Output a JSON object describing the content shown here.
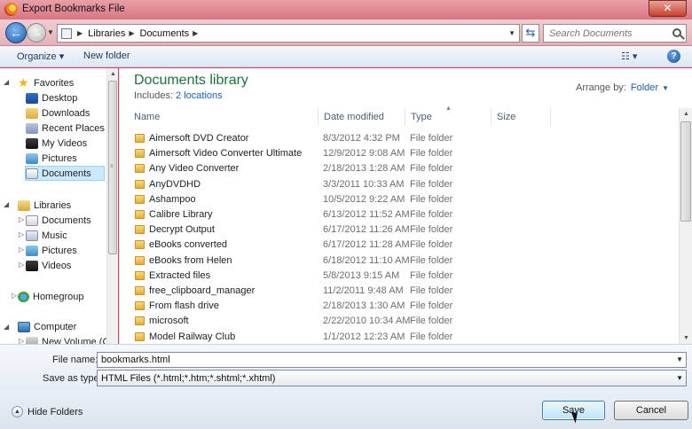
{
  "window": {
    "title": "Export Bookmarks File",
    "close_label": "✕"
  },
  "address": {
    "crumbs": [
      "Libraries",
      "Documents"
    ],
    "search_placeholder": "Search Documents"
  },
  "toolbar": {
    "organize_label": "Organize ▾",
    "new_folder_label": "New folder"
  },
  "nav": {
    "favorites": "Favorites",
    "favorite_items": [
      "Desktop",
      "Downloads",
      "Recent Places",
      "My Videos",
      "Pictures",
      "Documents"
    ],
    "libraries": "Libraries",
    "library_items": [
      "Documents",
      "Music",
      "Pictures",
      "Videos"
    ],
    "homegroup": "Homegroup",
    "computer": "Computer",
    "computer_items": [
      "New Volume (C:)"
    ]
  },
  "library": {
    "title": "Documents library",
    "includes_label": "Includes:",
    "includes_link": "2 locations",
    "arrange_label": "Arrange by:",
    "arrange_value": "Folder"
  },
  "columns": [
    "Name",
    "Date modified",
    "Type",
    "Size"
  ],
  "files": [
    {
      "name": "Aimersoft DVD Creator",
      "date": "8/3/2012 4:32 PM",
      "type": "File folder"
    },
    {
      "name": "Aimersoft Video Converter Ultimate",
      "date": "12/9/2012 9:08 AM",
      "type": "File folder"
    },
    {
      "name": "Any Video Converter",
      "date": "2/18/2013 1:28 AM",
      "type": "File folder"
    },
    {
      "name": "AnyDVDHD",
      "date": "3/3/2011 10:33 AM",
      "type": "File folder"
    },
    {
      "name": "Ashampoo",
      "date": "10/5/2012 9:22 AM",
      "type": "File folder"
    },
    {
      "name": "Calibre Library",
      "date": "6/13/2012 11:52 AM",
      "type": "File folder"
    },
    {
      "name": "Decrypt Output",
      "date": "6/17/2012 11:26 AM",
      "type": "File folder"
    },
    {
      "name": "eBooks converted",
      "date": "6/17/2012 11:28 AM",
      "type": "File folder"
    },
    {
      "name": "eBooks from Helen",
      "date": "6/18/2012 11:10 AM",
      "type": "File folder"
    },
    {
      "name": "Extracted files",
      "date": "5/8/2013 9:15 AM",
      "type": "File folder"
    },
    {
      "name": "free_clipboard_manager",
      "date": "11/2/2011 9:48 AM",
      "type": "File folder"
    },
    {
      "name": "From flash drive",
      "date": "2/18/2013 1:30 AM",
      "type": "File folder"
    },
    {
      "name": "microsoft",
      "date": "2/22/2010 10:34 AM",
      "type": "File folder"
    },
    {
      "name": "Model Railway Club",
      "date": "1/1/2012 12:23 AM",
      "type": "File folder"
    }
  ],
  "form": {
    "file_name_label": "File name:",
    "file_name_value": "bookmarks.html",
    "save_type_label": "Save as type:",
    "save_type_value": "HTML Files (*.html;*.htm;*.shtml;*.xhtml)"
  },
  "footer": {
    "hide_folders": "Hide Folders",
    "save_label": "Save",
    "cancel_label": "Cancel"
  }
}
